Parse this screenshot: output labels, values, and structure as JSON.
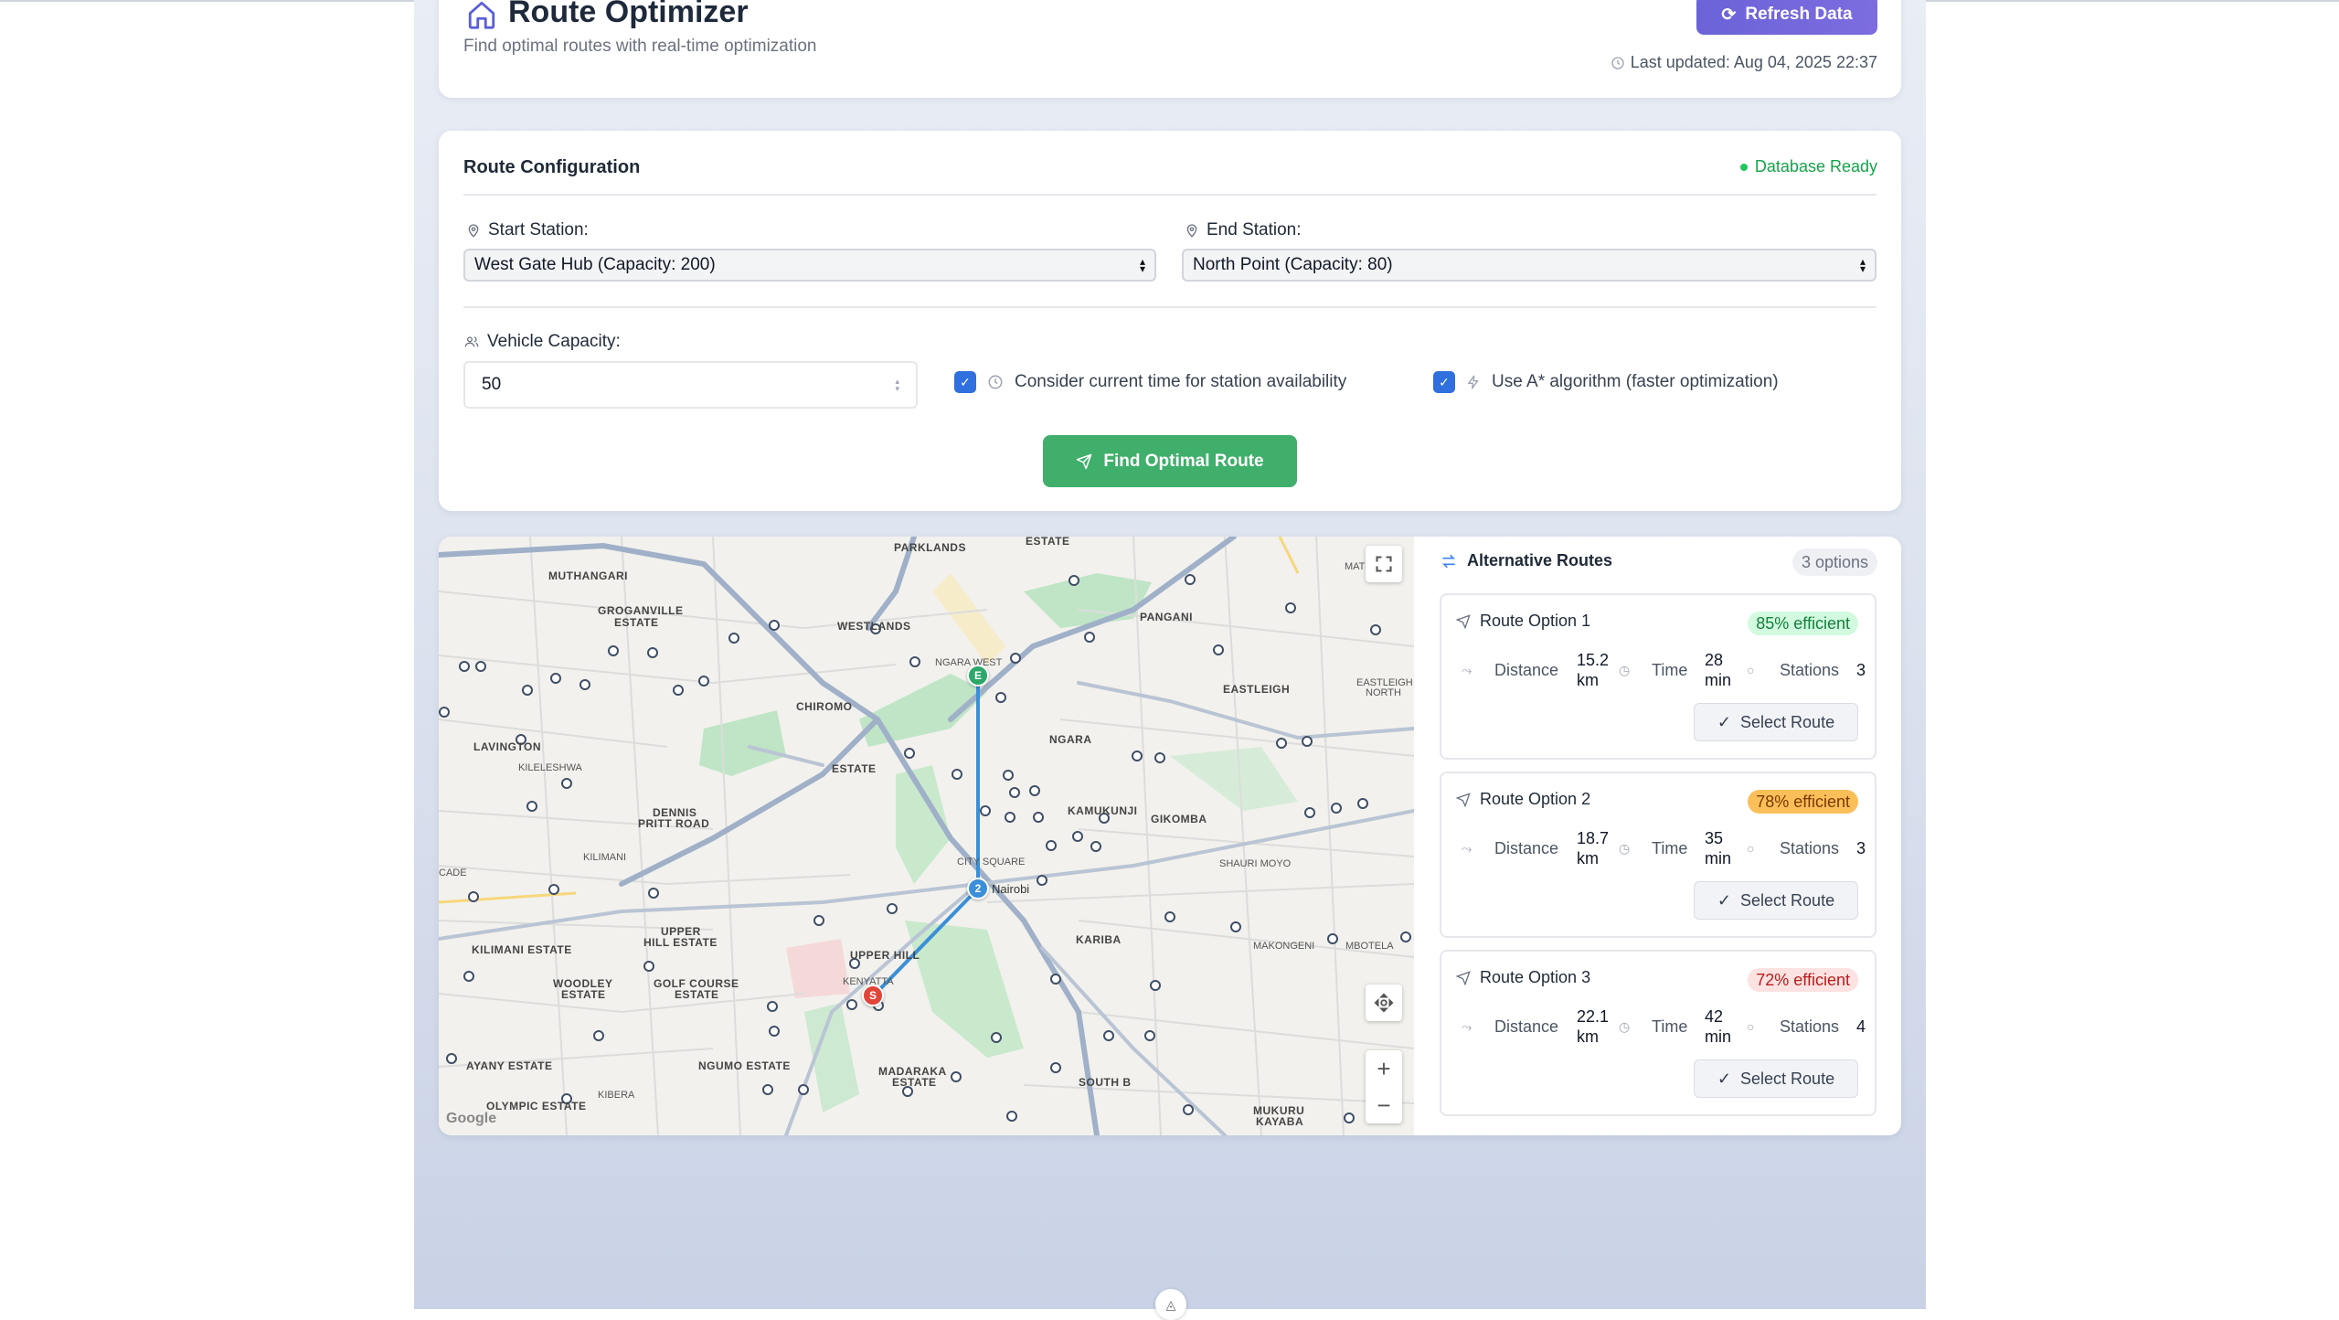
{
  "header": {
    "title": "Route Optimizer",
    "subtitle": "Find optimal routes with real-time optimization",
    "refresh_label": "Refresh Data",
    "last_updated": "Last updated: Aug 04, 2025 22:37"
  },
  "config": {
    "title": "Route Configuration",
    "db_status": "Database Ready",
    "start_label": "Start Station:",
    "start_value": "West Gate Hub (Capacity: 200)",
    "end_label": "End Station:",
    "end_value": "North Point (Capacity: 80)",
    "capacity_label": "Vehicle Capacity:",
    "capacity_value": "50",
    "opt_time_label": "Consider current time for station availability",
    "opt_astar_label": "Use A* algorithm (faster optimization)",
    "find_label": "Find Optimal Route"
  },
  "map": {
    "labels": {
      "parklands": "PARKLANDS",
      "estate_top": "ESTATE",
      "muthangari": "MUTHANGARI",
      "groganville": "GROGANVILLE",
      "groganville2": "ESTATE",
      "westlands": "WESTLANDS",
      "pangani": "PANGANI",
      "eastleigh": "EASTLEIGH",
      "eastleigh_n": "EASTLEIGH",
      "eastleigh_n2": "NORTH",
      "chiromo": "CHIROMO",
      "ngara_west": "NGARA WEST",
      "ngara": "NGARA",
      "lavington": "LAVINGTON",
      "kileleshwa": "KILELESHWA",
      "estate_mid": "ESTATE",
      "dennis": "DENNIS",
      "pritt": "PRITT ROAD",
      "kamukunji": "KAMUKUNJI",
      "gikomba": "GIKOMBA",
      "kilimani": "KILIMANI",
      "city_square": "CITY SQUARE",
      "upper_hill": "UPPER HILL",
      "upper_hill_estate": "UPPER",
      "upper_hill_estate2": "HILL ESTATE",
      "kilimani_estate": "KILIMANI ESTATE",
      "woodley": "WOODLEY",
      "woodley2": "ESTATE",
      "golf": "GOLF COURSE",
      "golf2": "ESTATE",
      "kariba": "KARIBA",
      "makongeni": "MAKONGENI",
      "mbotela": "MBOTELA",
      "shauri": "SHAURI MOYO",
      "kenyatta": "KENYATTA",
      "ngumo": "NGUMO ESTATE",
      "ayany": "AYANY ESTATE",
      "kibera": "KIBERA",
      "olympic": "OLYMPIC ESTATE",
      "madaraka": "MADARAKA",
      "madaraka2": "ESTATE",
      "south_b": "SOUTH B",
      "mukuru": "MUKURU",
      "kayaba": "KAYABA",
      "cade": "CADE",
      "nairobi": "Nairobi",
      "mat": "MAT"
    },
    "markers": {
      "end": "E",
      "mid": "2",
      "start": "S"
    },
    "google": "Google",
    "zoom_in": "+",
    "zoom_out": "−"
  },
  "alternatives": {
    "title": "Alternative Routes",
    "count": "3 options",
    "routes": [
      {
        "name": "Route Option 1",
        "efficiency": "85% efficient",
        "distance_label": "Distance",
        "distance_num": "15.2",
        "distance_unit": "km",
        "time_label": "Time",
        "time_num": "28",
        "time_unit": "min",
        "stations_label": "Stations",
        "stations": "3",
        "select": "Select Route"
      },
      {
        "name": "Route Option 2",
        "efficiency": "78% efficient",
        "distance_label": "Distance",
        "distance_num": "18.7",
        "distance_unit": "km",
        "time_label": "Time",
        "time_num": "35",
        "time_unit": "min",
        "stations_label": "Stations",
        "stations": "3",
        "select": "Select Route"
      },
      {
        "name": "Route Option 3",
        "efficiency": "72% efficient",
        "distance_label": "Distance",
        "distance_num": "22.1",
        "distance_unit": "km",
        "time_label": "Time",
        "time_num": "42",
        "time_unit": "min",
        "stations_label": "Stations",
        "stations": "4",
        "select": "Select Route"
      }
    ]
  },
  "colors": {
    "accent_purple": "#6b63d8",
    "find_green": "#3faf6b",
    "route_blue": "#3b8fd8",
    "end_marker": "#2ea86a",
    "start_marker": "#e0453a"
  }
}
